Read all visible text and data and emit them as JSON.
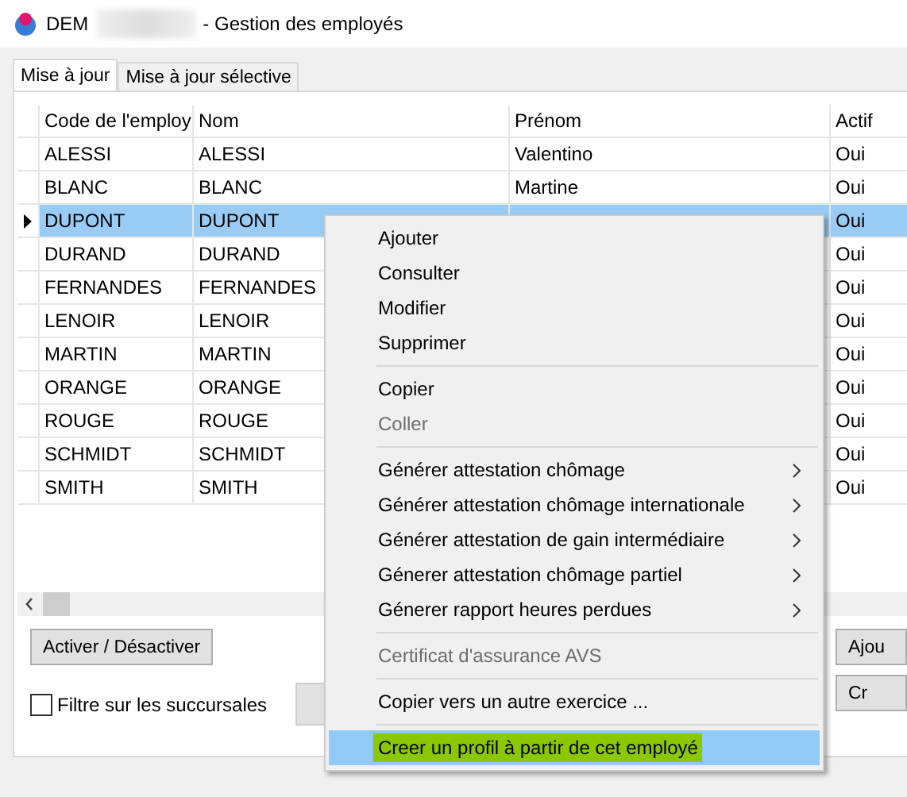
{
  "window": {
    "title_start": "DEM",
    "title_end": "- Gestion des employés"
  },
  "tabs": [
    {
      "label": "Mise à jour",
      "selected": true
    },
    {
      "label": "Mise à jour sélective",
      "selected": false
    }
  ],
  "table": {
    "columns": [
      "Code de l'employ",
      "Nom",
      "Prénom",
      "Actif"
    ],
    "rows": [
      {
        "code": "ALESSI",
        "nom": "ALESSI",
        "prenom": "Valentino",
        "actif": "Oui",
        "selected": false
      },
      {
        "code": "BLANC",
        "nom": "BLANC",
        "prenom": "Martine",
        "actif": "Oui",
        "selected": false
      },
      {
        "code": "DUPONT",
        "nom": "DUPONT",
        "actif": "Oui",
        "selected": true
      },
      {
        "code": "DURAND",
        "nom": "DURAND",
        "actif": "Oui",
        "selected": false
      },
      {
        "code": "FERNANDES",
        "nom": "FERNANDES",
        "actif": "Oui",
        "selected": false
      },
      {
        "code": "LENOIR",
        "nom": "LENOIR",
        "actif": "Oui",
        "selected": false
      },
      {
        "code": "MARTIN",
        "nom": "MARTIN",
        "actif": "Oui",
        "selected": false
      },
      {
        "code": "ORANGE",
        "nom": "ORANGE",
        "actif": "Oui",
        "selected": false
      },
      {
        "code": "ROUGE",
        "nom": "ROUGE",
        "actif": "Oui",
        "selected": false
      },
      {
        "code": "SCHMIDT",
        "nom": "SCHMIDT",
        "actif": "Oui",
        "selected": false
      },
      {
        "code": "SMITH",
        "nom": "SMITH",
        "actif": "Oui",
        "selected": false
      }
    ]
  },
  "left_button": "Activer / Désactiver",
  "filter_checkbox": {
    "label": "Filtre sur les succursales",
    "checked": false
  },
  "right_buttons": [
    "Ajou",
    "Cr"
  ],
  "context_menu": [
    {
      "kind": "item",
      "label": "Ajouter",
      "disabled": false,
      "submenu": false,
      "selected": false
    },
    {
      "kind": "item",
      "label": "Consulter",
      "disabled": false,
      "submenu": false,
      "selected": false
    },
    {
      "kind": "item",
      "label": "Modifier",
      "disabled": false,
      "submenu": false,
      "selected": false
    },
    {
      "kind": "item",
      "label": "Supprimer",
      "disabled": false,
      "submenu": false,
      "selected": false
    },
    {
      "kind": "separator"
    },
    {
      "kind": "item",
      "label": "Copier",
      "disabled": false,
      "submenu": false,
      "selected": false
    },
    {
      "kind": "item",
      "label": "Coller",
      "disabled": true,
      "submenu": false,
      "selected": false
    },
    {
      "kind": "separator"
    },
    {
      "kind": "item",
      "label": "Générer attestation chômage",
      "disabled": false,
      "submenu": true,
      "selected": false
    },
    {
      "kind": "item",
      "label": "Générer attestation chômage internationale",
      "disabled": false,
      "submenu": true,
      "selected": false
    },
    {
      "kind": "item",
      "label": "Générer attestation de gain intermédiaire",
      "disabled": false,
      "submenu": true,
      "selected": false
    },
    {
      "kind": "item",
      "label": "Génerer attestation chômage partiel",
      "disabled": false,
      "submenu": true,
      "selected": false
    },
    {
      "kind": "item",
      "label": "Génerer rapport heures perdues",
      "disabled": false,
      "submenu": true,
      "selected": false
    },
    {
      "kind": "separator"
    },
    {
      "kind": "item",
      "label": "Certificat d'assurance AVS",
      "disabled": true,
      "submenu": false,
      "selected": false
    },
    {
      "kind": "separator"
    },
    {
      "kind": "item",
      "label": "Copier vers un autre exercice ...",
      "disabled": false,
      "submenu": false,
      "selected": false
    },
    {
      "kind": "separator"
    },
    {
      "kind": "item",
      "label": "Creer un profil à partir de cet employé",
      "disabled": false,
      "submenu": false,
      "selected": true,
      "highlighted": true
    }
  ]
}
